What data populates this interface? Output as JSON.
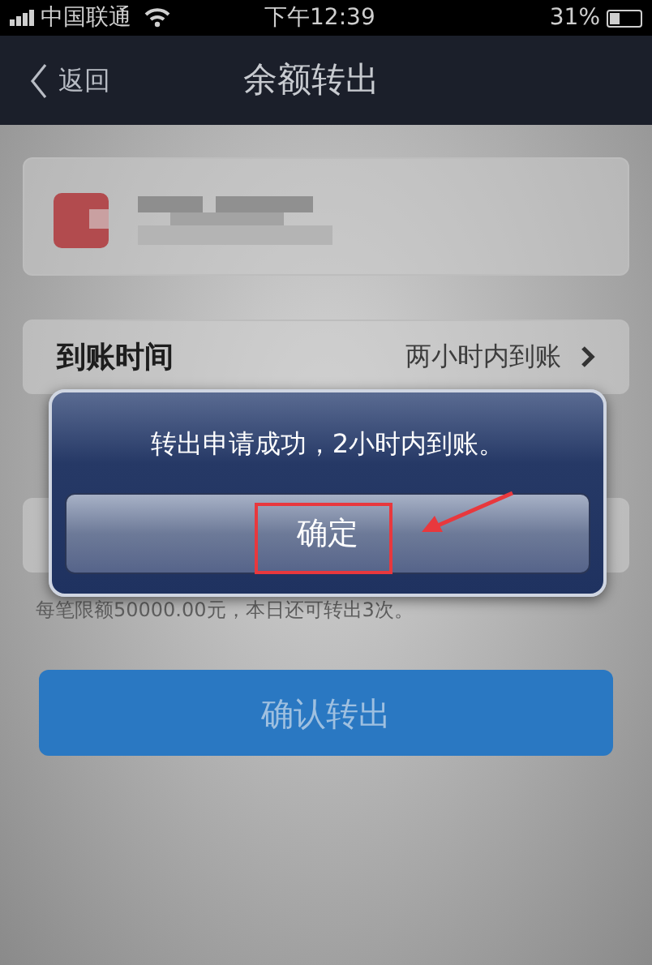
{
  "status_bar": {
    "carrier": "中国联通",
    "time": "下午12:39",
    "battery": "31%"
  },
  "nav_bar": {
    "back": "返回",
    "title": "余额转出"
  },
  "arrival_row": {
    "label": "到账时间",
    "value": "两小时内到账"
  },
  "amount_field": {
    "kind": "field"
  },
  "limit_note": "每笔限额50000.00元，本日还可转出3次。",
  "confirm_button": "确认转出",
  "alert": {
    "message": "转出申请成功，2小时内到账。",
    "button": "确定",
    "highlighted": true
  }
}
